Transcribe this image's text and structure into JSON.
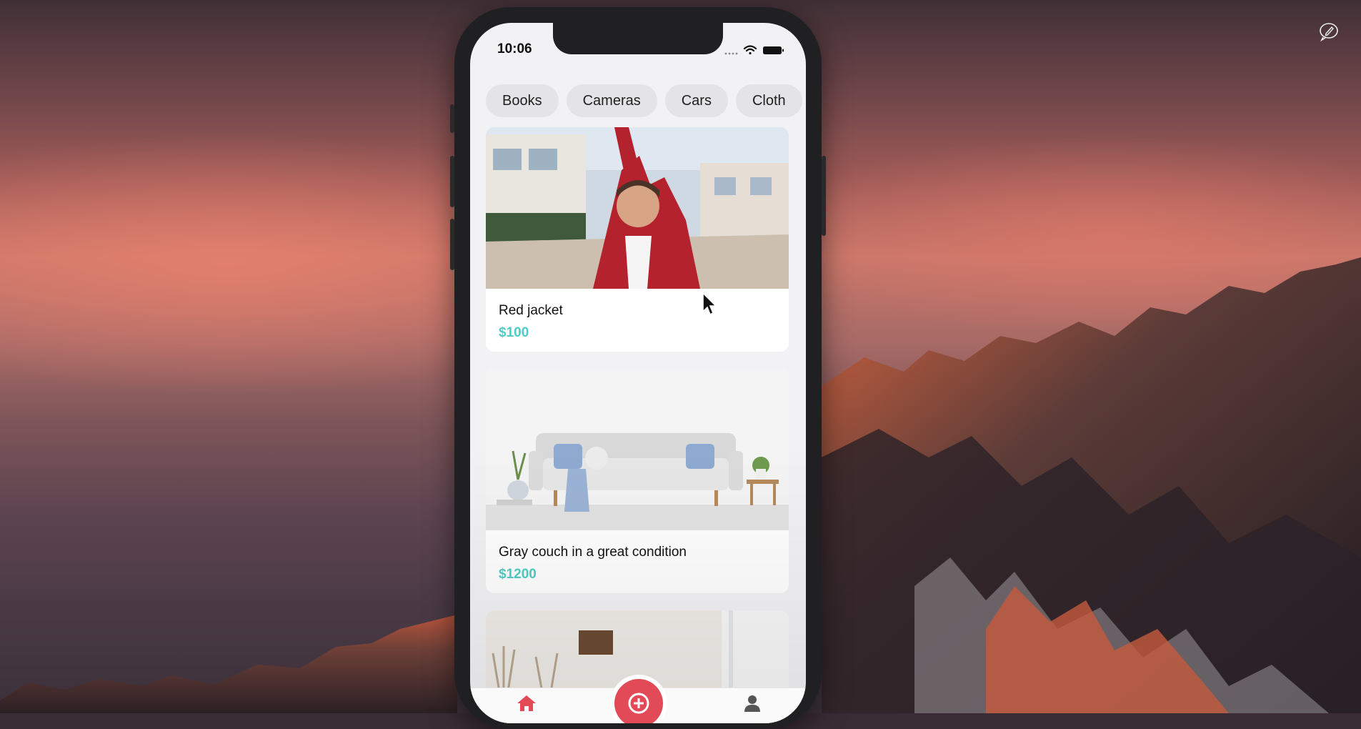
{
  "status_bar": {
    "time": "10:06"
  },
  "categories": [
    "Books",
    "Cameras",
    "Cars",
    "Cloth"
  ],
  "listings": [
    {
      "title": "Red jacket",
      "price": "$100"
    },
    {
      "title": "Gray couch in a great condition",
      "price": "$1200"
    }
  ],
  "tab_bar": {
    "items": [
      {
        "icon": "home-icon"
      },
      {
        "icon": "add-icon"
      },
      {
        "icon": "account-icon"
      }
    ]
  },
  "colors": {
    "price": "#4ecdc4",
    "add_button": "#e34a57",
    "chip_background": "#e4e4e6"
  },
  "desktop": {
    "corner_icon": "edit-pen-icon"
  }
}
